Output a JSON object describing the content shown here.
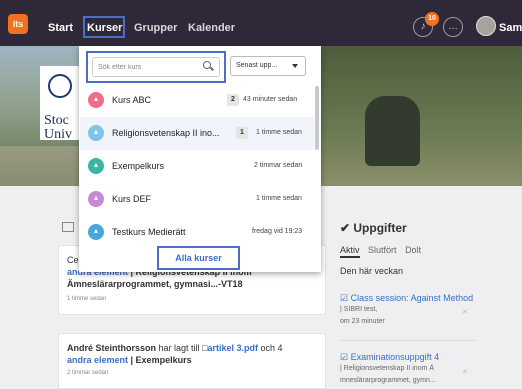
{
  "nav": {
    "logo": "its",
    "items": [
      "Start",
      "Kurser",
      "Grupper",
      "Kalender"
    ],
    "badge": "10",
    "user": "Sam"
  },
  "hero": {
    "brand_line1": "Stoc",
    "brand_line2": "Univ"
  },
  "dropdown": {
    "search_placeholder": "Sök efter kurs",
    "sort_label": "Senast upp...",
    "courses": [
      {
        "name": "Kurs ABC",
        "count": "2",
        "time": "43 minuter sedan",
        "color": "#f06d86"
      },
      {
        "name": "Religionsvetenskap II ino...",
        "count": "1",
        "time": "1 timme sedan",
        "color": "#7fc4e8"
      },
      {
        "name": "Exempelkurs",
        "count": "",
        "time": "2 timmar sedan",
        "color": "#3cb4a4"
      },
      {
        "name": "Kurs DEF",
        "count": "",
        "time": "1 timme sedan",
        "color": "#c888d6"
      },
      {
        "name": "Testkurs Medierätt",
        "count": "",
        "time": "fredag vid 19:23",
        "color": "#49a6dd"
      }
    ],
    "all_courses": "Alla kurser"
  },
  "feed": {
    "card1": {
      "line1_prefix": "Ce",
      "line2_link": "andra element",
      "line2_rest": " | Religionsvetenskap II inom",
      "line3": "Ämneslärarprogrammet, gymnasi...-VT18",
      "time": "1 timme sedan"
    },
    "card2": {
      "author": "André Steinthorsson",
      "action": " har lagt till ",
      "file": "artikel 3.pdf",
      "and": " och 4",
      "link2": "andra element",
      "course": " | Exempelkurs",
      "time": "2 timmar sedan"
    }
  },
  "tasks": {
    "title": "Uppgifter",
    "tabs": [
      "Aktiv",
      "Slutfört",
      "Dolt"
    ],
    "week": "Den här veckan",
    "items": [
      {
        "title": "Class session: Against Method",
        "course": "| SIBRI test,",
        "time": "om 23 minuter"
      },
      {
        "title": "Examinationsuppgift 4",
        "course": "| Religionsvetenskap II inom Ä",
        "extra": "mneslärarprogrammet, gymn..."
      }
    ]
  }
}
